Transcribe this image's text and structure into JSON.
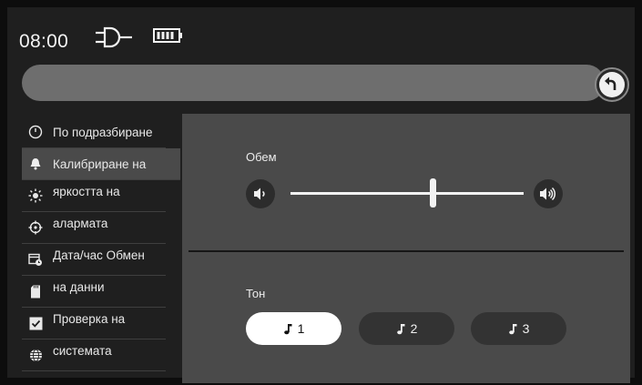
{
  "status": {
    "time": "08:00",
    "icons": [
      "plug-icon",
      "battery-icon"
    ]
  },
  "top_bar": {
    "back_icon": "back-arrow-icon"
  },
  "sidebar": {
    "items": [
      {
        "label": "По подразбиране",
        "icon": "gauge-icon",
        "active": false
      },
      {
        "label": "Калибриране на",
        "icon": "bell-icon",
        "active": true
      },
      {
        "label": "яркостта на",
        "icon": "brightness-icon",
        "active": false
      },
      {
        "label": "алармата",
        "icon": "crosshair-icon",
        "active": false
      },
      {
        "label": "Дата/час Обмен",
        "icon": "calendar-clock-icon",
        "active": false
      },
      {
        "label": "на данни",
        "icon": "sd-card-icon",
        "active": false
      },
      {
        "label": "Проверка на",
        "icon": "checkbox-icon",
        "active": false
      },
      {
        "label": "системата",
        "icon": "globe-icon",
        "active": false
      }
    ]
  },
  "volume": {
    "label": "Обем",
    "level": 0.6,
    "down_icon": "volume-down-icon",
    "up_icon": "volume-up-icon"
  },
  "tone": {
    "label": "Тон",
    "options": [
      {
        "label": "1",
        "selected": true
      },
      {
        "label": "2",
        "selected": false
      },
      {
        "label": "3",
        "selected": false
      }
    ],
    "icon": "music-note-icon"
  },
  "colors": {
    "background": "#1f1f1f",
    "panel": "#4a4a4a",
    "top_bar": "#6e6e6e",
    "accent": "#ffffff"
  }
}
